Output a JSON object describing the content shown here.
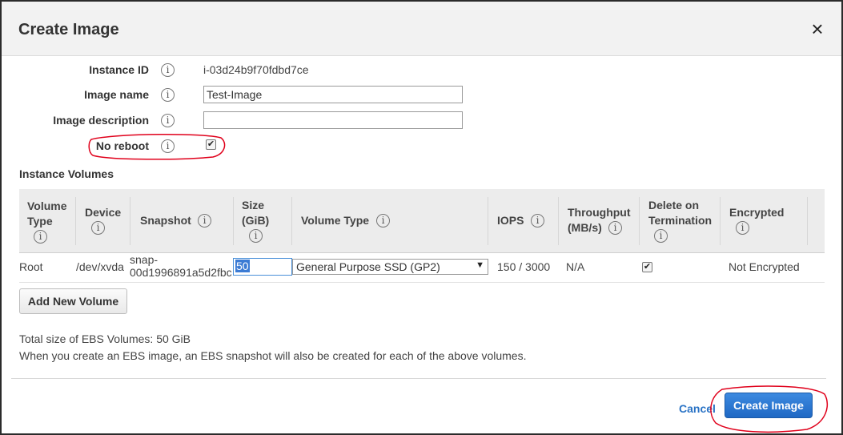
{
  "dialog": {
    "title": "Create Image",
    "close_symbol": "×"
  },
  "form": {
    "instance_id_label": "Instance ID",
    "instance_id_value": "i-03d24b9f70fdbd7ce",
    "image_name_label": "Image name",
    "image_name_value": "Test-Image",
    "image_description_label": "Image description",
    "image_description_value": "",
    "no_reboot_label": "No reboot",
    "no_reboot_checked": true
  },
  "volumes": {
    "section_title": "Instance Volumes",
    "headers": {
      "volume_type": [
        "Volume",
        "Type"
      ],
      "device": "Device",
      "snapshot": "Snapshot",
      "size": [
        "Size",
        "(GiB)"
      ],
      "volume_type_col": "Volume Type",
      "iops": "IOPS",
      "throughput": [
        "Throughput",
        "(MB/s)"
      ],
      "delete_on_termination": [
        "Delete on",
        "Termination"
      ],
      "encrypted": "Encrypted"
    },
    "rows": [
      {
        "volume_type": "Root",
        "device": "/dev/xvda",
        "snapshot_line1": "snap-",
        "snapshot_line2": "00d1996891a5d2fbc",
        "size": "50",
        "volume_type_value": "General Purpose SSD (GP2)",
        "iops": "150 / 3000",
        "throughput": "N/A",
        "delete_on_termination": true,
        "encrypted": "Not Encrypted"
      }
    ],
    "add_button": "Add New Volume"
  },
  "summary": {
    "total_size": "Total size of EBS Volumes: 50 GiB",
    "note": "When you create an EBS image, an EBS snapshot will also be created for each of the above volumes."
  },
  "footer": {
    "cancel_label": "Cancel",
    "create_label": "Create Image"
  },
  "icons": {
    "info": "i",
    "checkmark": "✔",
    "dropdown": "▼"
  },
  "colors": {
    "primary": "#1f68c4",
    "link": "#2a73c5",
    "annotation": "#e0001b"
  }
}
